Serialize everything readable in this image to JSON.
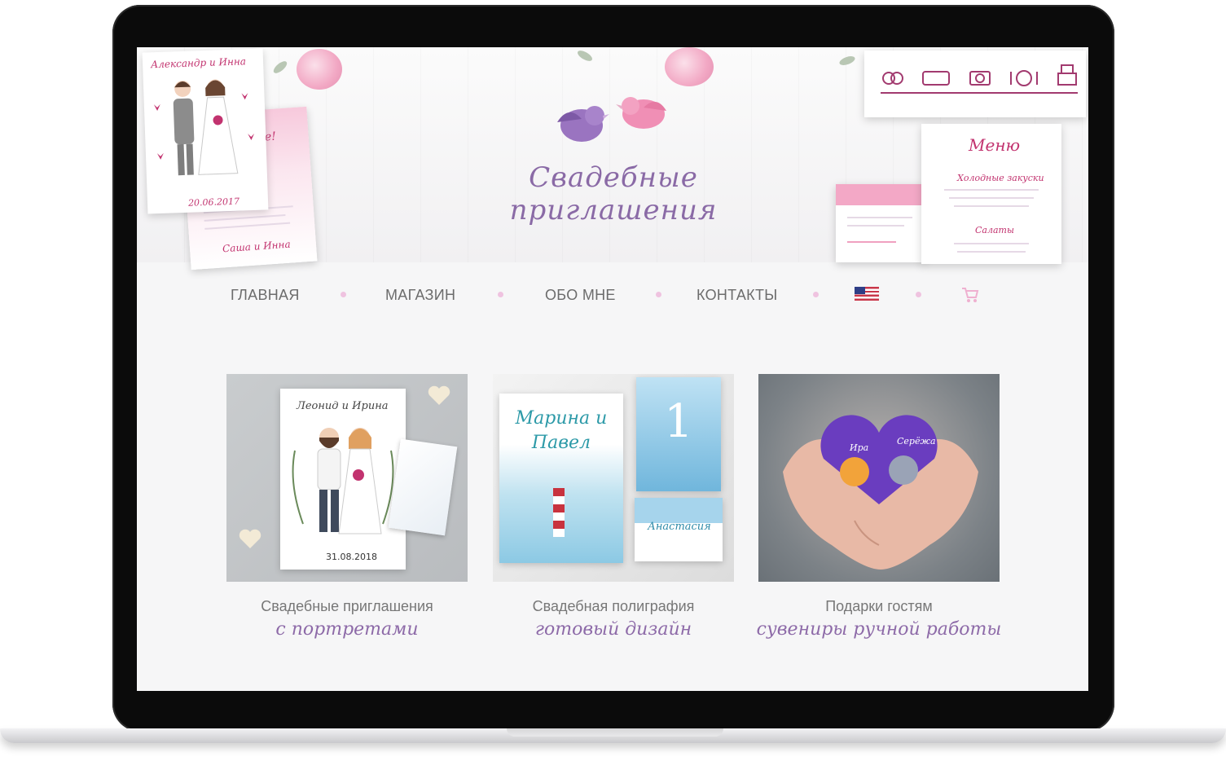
{
  "hero": {
    "title": "Свадебные приглашения",
    "card_names": "Александр и Инна",
    "card_date": "20.06.2017",
    "card_pink_heading": "Дорогие!",
    "card_pink_names": "Саша и Инна",
    "menu_title": "Меню",
    "menu_section_1": "Холодные закуски",
    "menu_section_2": "Салаты"
  },
  "nav": {
    "items": [
      {
        "label": "ГЛАВНАЯ"
      },
      {
        "label": "МАГАЗИН"
      },
      {
        "label": "ОБО МНЕ"
      },
      {
        "label": "КОНТАКТЫ"
      }
    ]
  },
  "products": [
    {
      "title": "Свадебные приглашения",
      "subtitle": "с портретами",
      "image_text": "Леонид и Ирина",
      "image_date": "31.08.2018"
    },
    {
      "title": "Свадебная полиграфия",
      "subtitle": "готовый дизайн",
      "image_text": "Марина и Павел",
      "image_number": "1",
      "image_name": "Анастасия"
    },
    {
      "title": "Подарки гостям",
      "subtitle": "сувениры ручной работы",
      "image_name_1": "Ира",
      "image_name_2": "Серёжа"
    }
  ],
  "colors": {
    "accent_purple": "#8a6aa6",
    "accent_pink": "#c2336f",
    "nav_text": "#6c6c6c",
    "nav_dot": "#efc3e0"
  }
}
